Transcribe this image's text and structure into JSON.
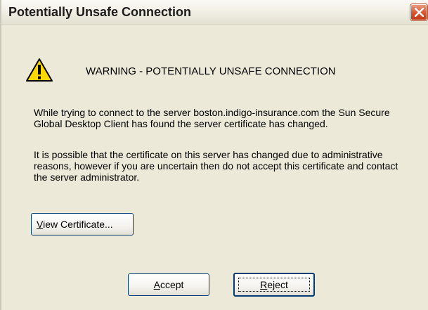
{
  "window": {
    "title": "Potentially Unsafe Connection"
  },
  "warning": {
    "heading": "WARNING - POTENTIALLY UNSAFE CONNECTION",
    "icon": "warning-triangle-icon"
  },
  "message": {
    "paragraph1": "While trying to connect to the server boston.indigo-insurance.com the Sun Secure Global Desktop Client has found the server certificate has changed.",
    "paragraph2": "It is possible that the certificate on this server has changed due to administrative reasons, however if you are uncertain then do not accept this certificate and contact the server administrator."
  },
  "buttons": {
    "view_certificate": {
      "mnemonic": "V",
      "rest": "iew Certificate..."
    },
    "accept": {
      "mnemonic": "A",
      "rest": "ccept"
    },
    "reject": {
      "mnemonic": "R",
      "rest": "eject"
    }
  },
  "colors": {
    "dialog_background": "#ece9d8",
    "close_button": "#d9542f",
    "warning_icon": "#ffd800"
  }
}
